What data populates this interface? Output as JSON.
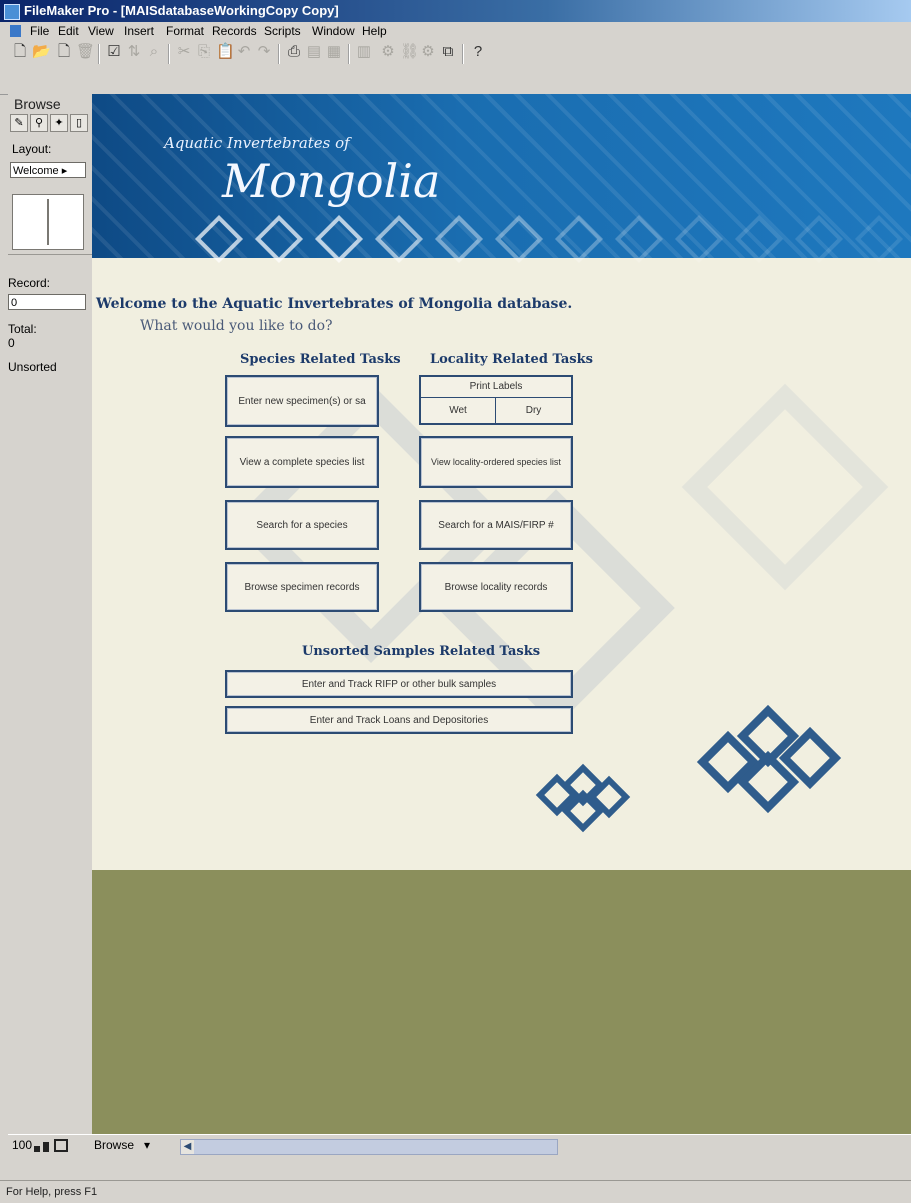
{
  "window": {
    "title": "FileMaker Pro - [MAISdatabaseWorkingCopy Copy]"
  },
  "menubar": [
    "File",
    "Edit",
    "View",
    "Insert",
    "Format",
    "Records",
    "Scripts",
    "Window",
    "Help"
  ],
  "sidebar": {
    "mode": "Browse",
    "layout_label": "Layout:",
    "layout_value": "Welcome",
    "record_label": "Record:",
    "record_value": "0",
    "total_label": "Total:",
    "total_value": "0",
    "sort_status": "Unsorted"
  },
  "banner": {
    "subtitle": "Aquatic Invertebrates of",
    "title": "Mongolia"
  },
  "welcome": {
    "heading": "Welcome to the Aquatic Invertebrates of Mongolia database.",
    "question": "What would you like to do?"
  },
  "species": {
    "heading": "Species Related Tasks",
    "buttons": [
      "Enter new specimen(s) or sa",
      "View a complete species list",
      "Search for a species",
      "Browse specimen records"
    ]
  },
  "locality": {
    "heading": "Locality Related Tasks",
    "print_labels": "Print Labels",
    "wet": "Wet",
    "dry": "Dry",
    "buttons": [
      "View locality-ordered species list",
      "Search for a MAIS/FIRP #",
      "Browse locality records"
    ]
  },
  "unsorted": {
    "heading": "Unsorted Samples Related Tasks",
    "buttons": [
      "Enter and Track RIFP or other bulk samples",
      "Enter and Track Loans and Depositories"
    ]
  },
  "statusbar": {
    "zoom": "100",
    "mode": "Browse",
    "help": "For Help, press F1"
  }
}
